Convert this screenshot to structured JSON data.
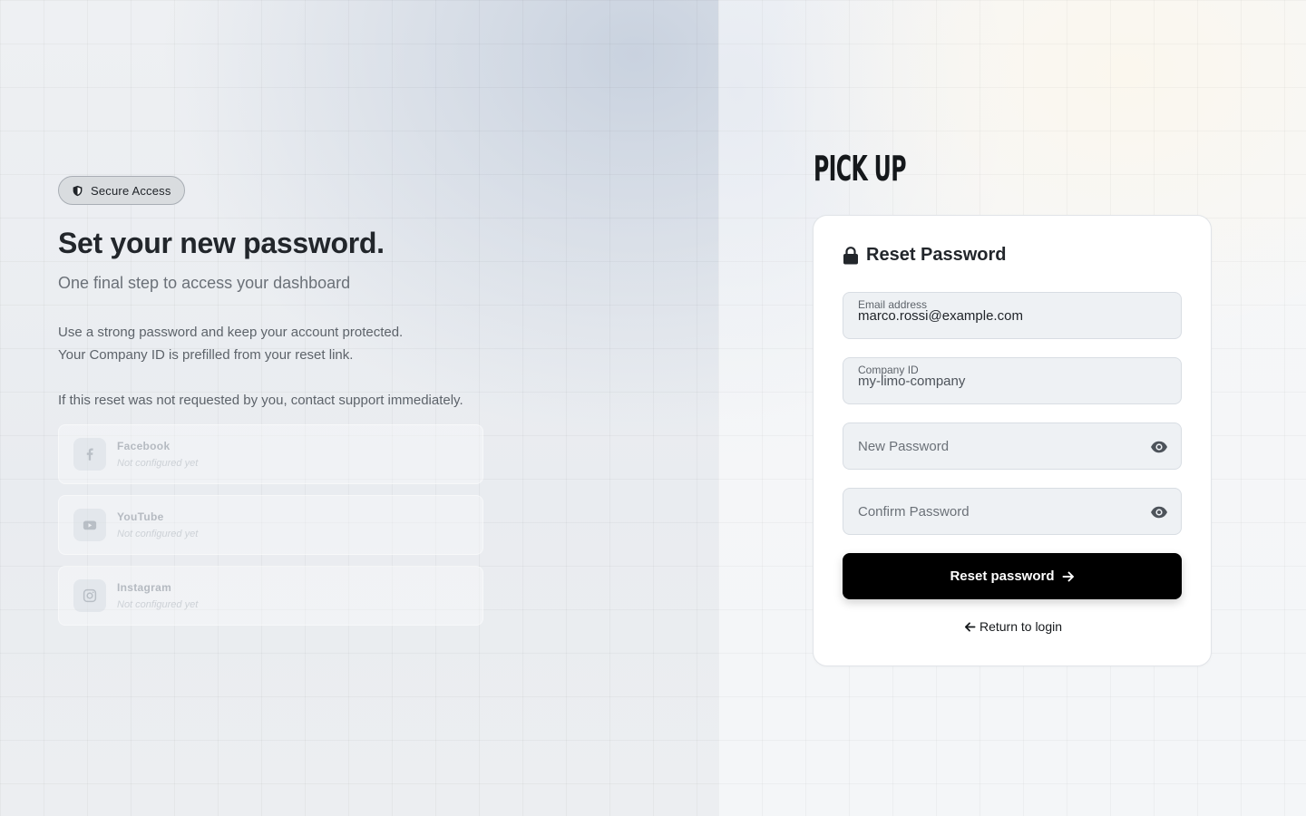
{
  "left": {
    "badge": {
      "icon": "shield-icon",
      "label": "Secure Access"
    },
    "headline": "Set your new password.",
    "subhead": "One final step to access your dashboard",
    "description_line1": "Use a strong password and keep your account protected.",
    "description_line2": "Your Company ID is prefilled from your reset link.",
    "warning": "If this reset was not requested by you, contact support immediately.",
    "socials": [
      {
        "icon": "facebook-icon",
        "name": "Facebook",
        "status": "Not configured yet"
      },
      {
        "icon": "youtube-icon",
        "name": "YouTube",
        "status": "Not configured yet"
      },
      {
        "icon": "instagram-icon",
        "name": "Instagram",
        "status": "Not configured yet"
      }
    ]
  },
  "right": {
    "logo": "PICK UP",
    "card": {
      "title": "Reset Password",
      "title_icon": "lock-icon",
      "email": {
        "label": "Email address",
        "value": "marco.rossi@example.com"
      },
      "company": {
        "label": "Company ID",
        "value": "my-limo-company"
      },
      "new_password": {
        "placeholder": "New Password",
        "icon": "eye-icon"
      },
      "confirm_password": {
        "placeholder": "Confirm Password",
        "icon": "eye-icon"
      },
      "submit_label": "Reset password",
      "return_label": "Return to login"
    }
  },
  "colors": {
    "primary_button": "#000000",
    "field_background": "#eef1f4",
    "card_background": "#ffffff"
  }
}
